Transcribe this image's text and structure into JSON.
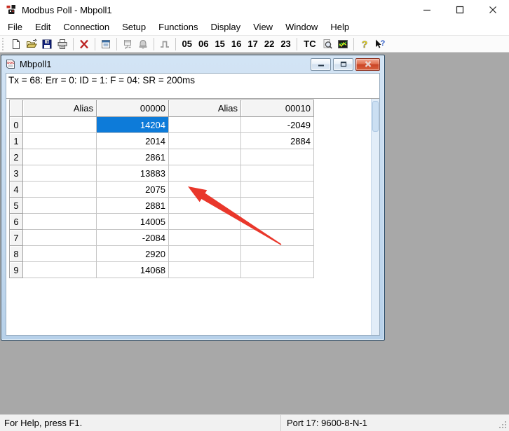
{
  "titlebar": {
    "title": "Modbus Poll - Mbpoll1"
  },
  "menu": {
    "items": [
      "File",
      "Edit",
      "Connection",
      "Setup",
      "Functions",
      "Display",
      "View",
      "Window",
      "Help"
    ]
  },
  "toolbar": {
    "function_buttons": [
      "05",
      "06",
      "15",
      "16",
      "17",
      "22",
      "23"
    ],
    "tc_label": "TC",
    "icon_names": [
      "new-icon",
      "open-icon",
      "save-icon",
      "print-icon",
      "disconnect-icon",
      "read-write-definition-icon",
      "communication-traffic-icon",
      "log-icon",
      "single-poll-icon",
      "test-center-icon",
      "find-icon",
      "chart-icon",
      "help-icon",
      "context-help-icon"
    ]
  },
  "child_window": {
    "title": "Mbpoll1",
    "poll_status": "Tx = 68: Err = 0: ID = 1: F = 04: SR = 200ms",
    "grid": {
      "headers": [
        "",
        "Alias",
        "00000",
        "Alias",
        "00010"
      ],
      "rows": [
        {
          "n": "0",
          "alias1": "",
          "v1": "14204",
          "alias2": "",
          "v2": "-2049"
        },
        {
          "n": "1",
          "alias1": "",
          "v1": "2014",
          "alias2": "",
          "v2": "2884"
        },
        {
          "n": "2",
          "alias1": "",
          "v1": "2861",
          "alias2": "",
          "v2": ""
        },
        {
          "n": "3",
          "alias1": "",
          "v1": "13883",
          "alias2": "",
          "v2": ""
        },
        {
          "n": "4",
          "alias1": "",
          "v1": "2075",
          "alias2": "",
          "v2": ""
        },
        {
          "n": "5",
          "alias1": "",
          "v1": "2881",
          "alias2": "",
          "v2": ""
        },
        {
          "n": "6",
          "alias1": "",
          "v1": "14005",
          "alias2": "",
          "v2": ""
        },
        {
          "n": "7",
          "alias1": "",
          "v1": "-2084",
          "alias2": "",
          "v2": ""
        },
        {
          "n": "8",
          "alias1": "",
          "v1": "2920",
          "alias2": "",
          "v2": ""
        },
        {
          "n": "9",
          "alias1": "",
          "v1": "14068",
          "alias2": "",
          "v2": ""
        }
      ],
      "selected": {
        "row": 0,
        "col": "v1"
      }
    }
  },
  "statusbar": {
    "left": "For Help, press F1.",
    "right": "Port 17: 9600-8-N-1"
  },
  "annotation": {
    "type": "red-arrow",
    "color": "#e9372b"
  },
  "colors": {
    "selection_blue": "#0d7bd9",
    "arrow_red": "#e9372b",
    "mdi_background": "#a8a8a8",
    "child_frame_blue": "#bdd6ee",
    "close_button_red": "#d9603c"
  }
}
